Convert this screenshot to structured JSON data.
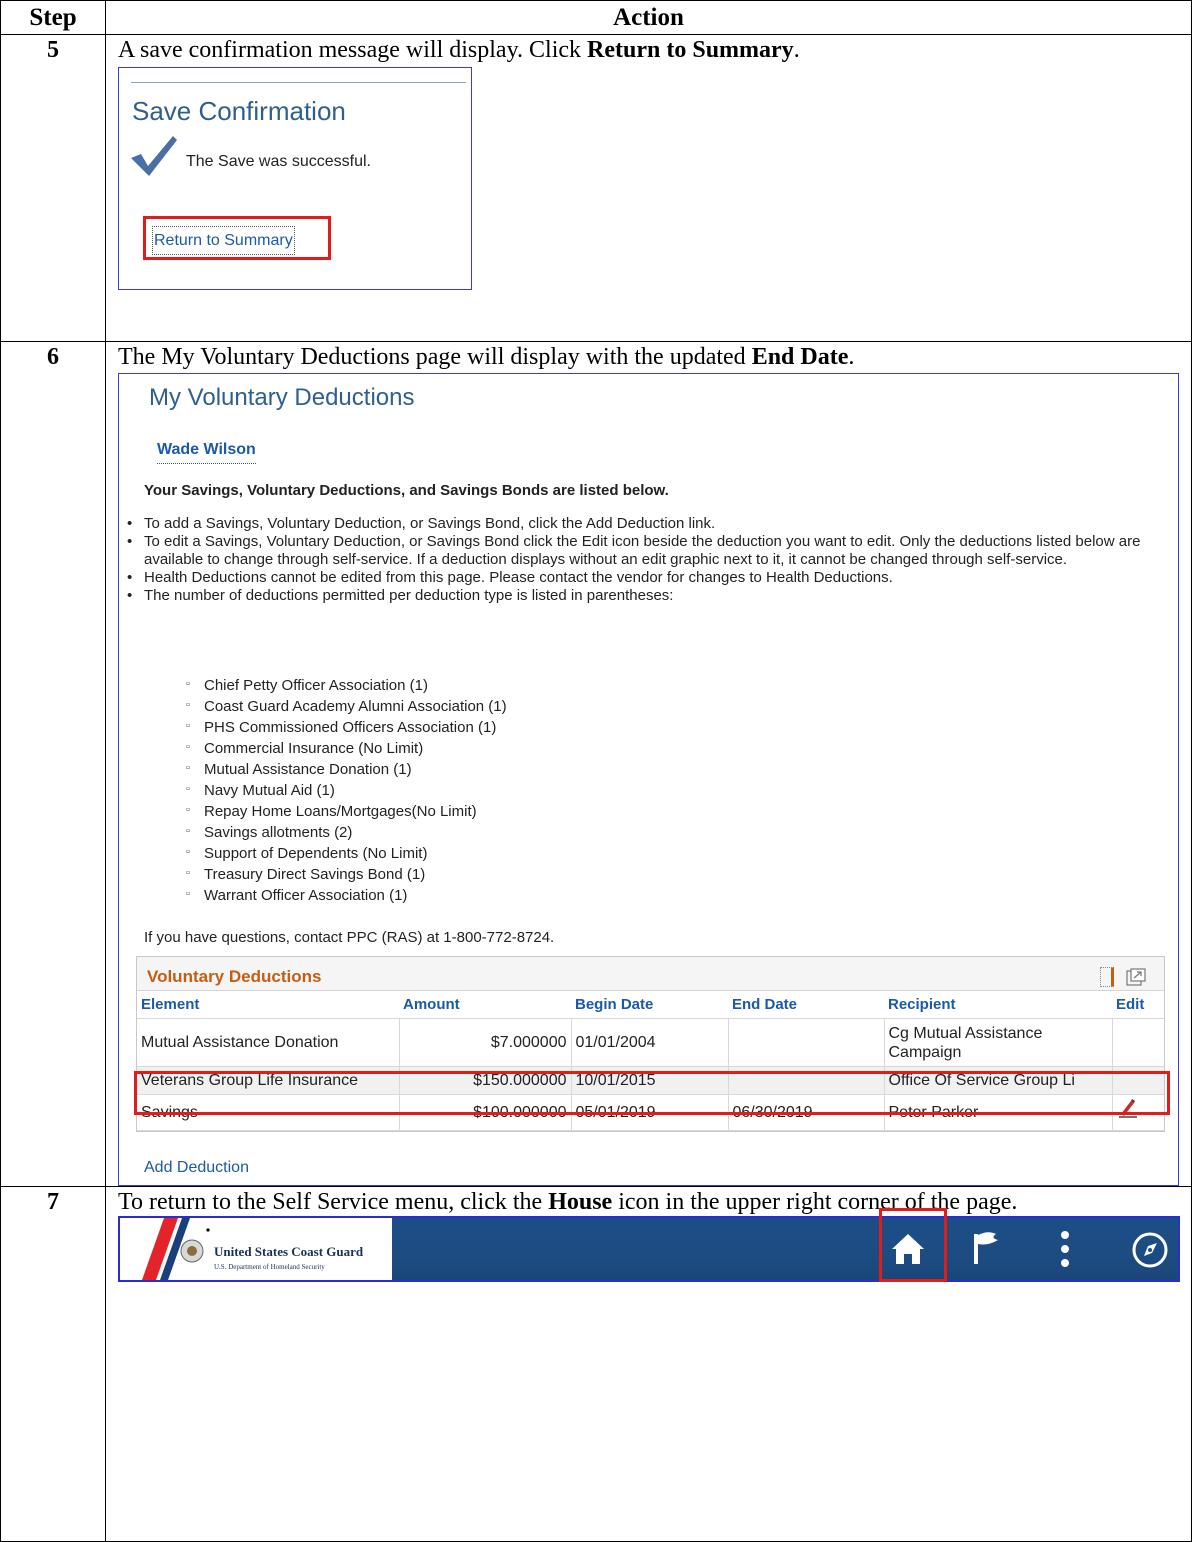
{
  "table": {
    "header_step": "Step",
    "header_action": "Action"
  },
  "steps": [
    {
      "num": "5",
      "text_before": "A save confirmation message will display.  Click ",
      "bold": "Return to Summary",
      "text_after": "."
    },
    {
      "num": "6",
      "text_before": "The My Voluntary Deductions page will display with the updated ",
      "bold": "End Date",
      "text_after": "."
    },
    {
      "num": "7",
      "text_before": "To return to the Self Service menu, click the ",
      "bold": "House",
      "text_after": " icon in the upper right corner of the page."
    }
  ],
  "save_confirmation": {
    "title": "Save Confirmation",
    "message": "The Save was successful.",
    "link": "Return to Summary"
  },
  "deductions_page": {
    "title": "My Voluntary Deductions",
    "employee": "Wade Wilson",
    "intro": "Your Savings, Voluntary Deductions, and Savings Bonds are listed below.",
    "bullets": [
      "To add a Savings, Voluntary Deduction, or Savings Bond, click the Add Deduction link.",
      "To edit a Savings, Voluntary Deduction, or Savings Bond click the Edit icon beside the deduction you want to edit. Only the deductions listed below are available to change through self-service. If a deduction displays without an edit graphic next to it, it cannot be changed through self-service.",
      "Health Deductions cannot be edited from this page. Please contact the vendor for changes to Health Deductions.",
      "The number of deductions permitted per deduction type is listed in parentheses:"
    ],
    "limits": [
      "Chief Petty Officer Association (1)",
      "Coast Guard Academy Alumni Association (1)",
      "PHS Commissioned Officers Association (1)",
      "Commercial Insurance (No Limit)",
      "Mutual Assistance Donation (1)",
      "Navy Mutual Aid (1)",
      "Repay Home Loans/Mortgages(No Limit)",
      "Savings allotments (2)",
      "Support of Dependents (No Limit)",
      "Treasury Direct Savings Bond (1)",
      "Warrant Officer Association (1)"
    ],
    "contact": "If you have questions, contact PPC (RAS) at 1-800-772-8724.",
    "grid": {
      "title": "Voluntary Deductions",
      "columns": [
        "Element",
        "Amount",
        "Begin Date",
        "End Date",
        "Recipient",
        "Edit"
      ],
      "rows": [
        {
          "element": "Mutual Assistance Donation",
          "amount": "$7.000000",
          "begin": "01/01/2004",
          "end": "",
          "recipient": "Cg Mutual Assistance Campaign"
        },
        {
          "element": "Veterans Group Life Insurance",
          "amount": "$150.000000",
          "begin": "10/01/2015",
          "end": "",
          "recipient": "Office Of Service Group Li"
        },
        {
          "element": "Savings",
          "amount": "$100.000000",
          "begin": "05/01/2019",
          "end": "06/30/2019",
          "recipient": "Peter Parker"
        }
      ]
    },
    "add_link": "Add Deduction"
  },
  "banner": {
    "org_name": "United States Coast Guard",
    "org_sub": "U.S. Department of Homeland Security",
    "icons": [
      "home-icon",
      "flag-icon",
      "menu-dots-icon",
      "compass-icon"
    ]
  },
  "colors": {
    "highlight": "#e21b1b",
    "link": "#1b5aa8",
    "banner": "#1c4e86"
  }
}
